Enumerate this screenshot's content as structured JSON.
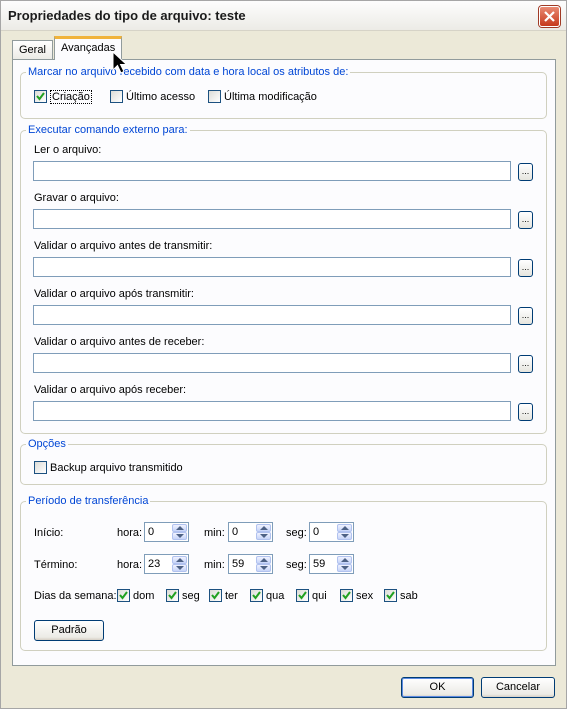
{
  "window": {
    "title": "Propriedades do tipo de arquivo: teste"
  },
  "tabs": [
    {
      "label": "Geral",
      "active": false
    },
    {
      "label": "Avançadas",
      "active": true
    }
  ],
  "attributes": {
    "legend": "Marcar no arquivo recebido com data e hora local os atributos de:",
    "items": [
      {
        "label": "Criação",
        "checked": true
      },
      {
        "label": "Último acesso",
        "checked": false
      },
      {
        "label": "Última modificação",
        "checked": false
      }
    ]
  },
  "commands": {
    "legend": "Executar comando externo para:",
    "browse_label": "...",
    "fields": [
      {
        "label": "Ler o arquivo:",
        "value": ""
      },
      {
        "label": "Gravar o arquivo:",
        "value": ""
      },
      {
        "label": "Validar o arquivo antes de transmitir:",
        "value": ""
      },
      {
        "label": "Validar o arquivo após transmitir:",
        "value": ""
      },
      {
        "label": "Validar o arquivo antes de receber:",
        "value": ""
      },
      {
        "label": "Validar o arquivo após receber:",
        "value": ""
      }
    ]
  },
  "options": {
    "legend": "Opções",
    "backup_label": "Backup arquivo transmitido",
    "backup_checked": false
  },
  "transfer": {
    "legend": "Período de transferência",
    "start_label": "Início:",
    "end_label": "Término:",
    "hour_label": "hora:",
    "min_label": "min:",
    "sec_label": "seg:",
    "start": {
      "hour": "0",
      "min": "0",
      "sec": "0"
    },
    "end": {
      "hour": "23",
      "min": "59",
      "sec": "59"
    },
    "weekdays_label": "Dias da semana:",
    "days": [
      {
        "label": "dom",
        "checked": true
      },
      {
        "label": "seg",
        "checked": true
      },
      {
        "label": "ter",
        "checked": true
      },
      {
        "label": "qua",
        "checked": true
      },
      {
        "label": "qui",
        "checked": true
      },
      {
        "label": "sex",
        "checked": true
      },
      {
        "label": "sab",
        "checked": true
      }
    ],
    "default_button": "Padrão"
  },
  "footer": {
    "ok_label": "OK",
    "cancel_label": "Cancelar"
  },
  "colors": {
    "legend_blue": "#0046d5",
    "window_bg": "#ECE9D8",
    "tab_highlight": "#f0b33b",
    "check_green": "#21a121"
  }
}
